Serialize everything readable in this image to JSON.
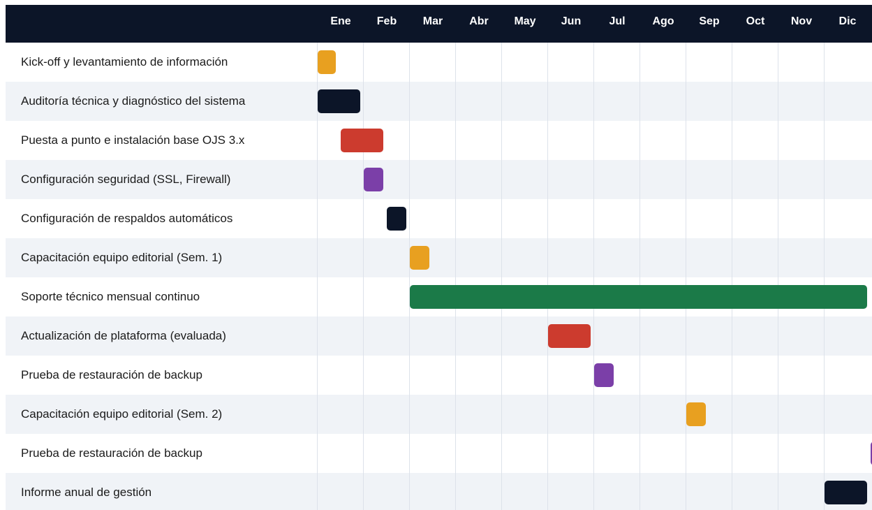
{
  "colors": {
    "header_bg": "#0c1528",
    "row_alt": "#f0f3f7",
    "grid": "#dde2ea",
    "orange": "#e8a020",
    "navy": "#0c1528",
    "red": "#cc3b2e",
    "purple": "#7b3fa8",
    "green": "#1b7a48"
  },
  "chart_data": {
    "type": "gantt",
    "months": [
      "Ene",
      "Feb",
      "Mar",
      "Abr",
      "May",
      "Jun",
      "Jul",
      "Ago",
      "Sep",
      "Oct",
      "Nov",
      "Dic"
    ],
    "tasks": [
      {
        "label": "Kick-off y levantamiento de información",
        "start": 0.0,
        "end": 0.4,
        "color": "orange"
      },
      {
        "label": "Auditoría técnica y diagnóstico del sistema",
        "start": 0.0,
        "end": 0.92,
        "color": "navy"
      },
      {
        "label": "Puesta a punto e instalación base OJS 3.x",
        "start": 0.5,
        "end": 1.42,
        "color": "red"
      },
      {
        "label": "Configuración seguridad (SSL, Firewall)",
        "start": 1.0,
        "end": 1.42,
        "color": "purple"
      },
      {
        "label": "Configuración de respaldos automáticos",
        "start": 1.5,
        "end": 1.92,
        "color": "navy"
      },
      {
        "label": "Capacitación equipo editorial (Sem. 1)",
        "start": 2.0,
        "end": 2.42,
        "color": "orange"
      },
      {
        "label": "Soporte técnico mensual continuo",
        "start": 2.0,
        "end": 11.92,
        "color": "green"
      },
      {
        "label": "Actualización de plataforma (evaluada)",
        "start": 5.0,
        "end": 5.92,
        "color": "red"
      },
      {
        "label": "Prueba de restauración de backup",
        "start": 6.0,
        "end": 6.42,
        "color": "purple"
      },
      {
        "label": "Capacitación equipo editorial (Sem. 2)",
        "start": 8.0,
        "end": 8.42,
        "color": "orange"
      },
      {
        "label": "Prueba de restauración de backup",
        "start": 12.0,
        "end": 12.42,
        "color": "purple"
      },
      {
        "label": "Informe anual de gestión",
        "start": 11.0,
        "end": 11.92,
        "color": "navy"
      }
    ]
  }
}
